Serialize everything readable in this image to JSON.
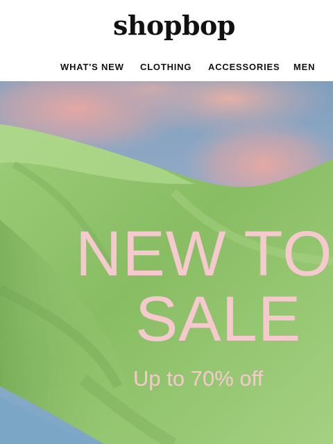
{
  "header": {
    "logo": "shopbop",
    "nav": [
      "WHAT'S NEW",
      "CLOTHING",
      "ACCESSORIES",
      "MEN"
    ]
  },
  "hero": {
    "headline_line1": "NEW TO",
    "headline_line2": "SALE",
    "subline": "Up to 70% off"
  },
  "colors": {
    "headline": "#f6c9cf",
    "fabric": "#8fc16a",
    "sky": "#8fa8c4",
    "cloud": "#e7a9a6"
  }
}
